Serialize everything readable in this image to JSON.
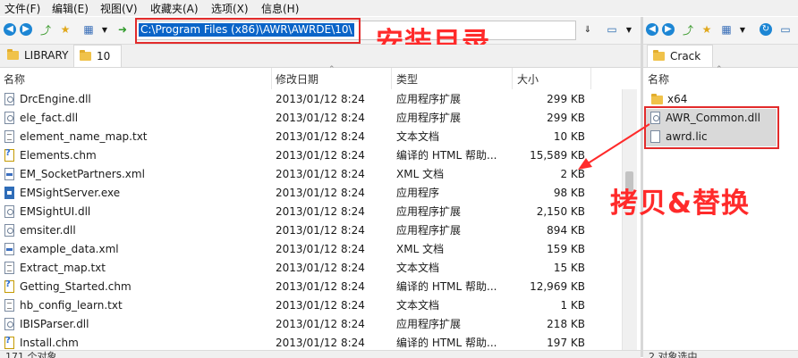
{
  "menu": [
    "文件(F)",
    "编辑(E)",
    "视图(V)",
    "收藏夹(A)",
    "选项(X)",
    "信息(H)"
  ],
  "address": {
    "path": "C:\\Program Files (x86)\\AWR\\AWRDE\\10\\"
  },
  "annotations": {
    "install_dir": "安装目录",
    "copy_replace": "拷贝&替换"
  },
  "left_tabs": [
    {
      "label": "LIBRARY"
    },
    {
      "label": "10"
    }
  ],
  "columns": {
    "name": "名称",
    "date": "修改日期",
    "type": "类型",
    "size": "大小"
  },
  "files": [
    {
      "name": "DrcEngine.dll",
      "date": "2013/01/12 8:24",
      "type": "应用程序扩展",
      "size": "299 KB",
      "icon": "dll-file-icon"
    },
    {
      "name": "ele_fact.dll",
      "date": "2013/01/12 8:24",
      "type": "应用程序扩展",
      "size": "299 KB",
      "icon": "dll-file-icon"
    },
    {
      "name": "element_name_map.txt",
      "date": "2013/01/12 8:24",
      "type": "文本文档",
      "size": "10 KB",
      "icon": "txt-file-icon"
    },
    {
      "name": "Elements.chm",
      "date": "2013/01/12 8:24",
      "type": "编译的 HTML 帮助...",
      "size": "15,589 KB",
      "icon": "chm-file-icon"
    },
    {
      "name": "EM_SocketPartners.xml",
      "date": "2013/01/12 8:24",
      "type": "XML 文档",
      "size": "2 KB",
      "icon": "xml-file-icon"
    },
    {
      "name": "EMSightServer.exe",
      "date": "2013/01/12 8:24",
      "type": "应用程序",
      "size": "98 KB",
      "icon": "exe-file-icon"
    },
    {
      "name": "EMSightUI.dll",
      "date": "2013/01/12 8:24",
      "type": "应用程序扩展",
      "size": "2,150 KB",
      "icon": "dll-file-icon"
    },
    {
      "name": "emsiter.dll",
      "date": "2013/01/12 8:24",
      "type": "应用程序扩展",
      "size": "894 KB",
      "icon": "dll-file-icon"
    },
    {
      "name": "example_data.xml",
      "date": "2013/01/12 8:24",
      "type": "XML 文档",
      "size": "159 KB",
      "icon": "xml-file-icon"
    },
    {
      "name": "Extract_map.txt",
      "date": "2013/01/12 8:24",
      "type": "文本文档",
      "size": "15 KB",
      "icon": "txt-file-icon"
    },
    {
      "name": "Getting_Started.chm",
      "date": "2013/01/12 8:24",
      "type": "编译的 HTML 帮助...",
      "size": "12,969 KB",
      "icon": "chm-file-icon"
    },
    {
      "name": "hb_config_learn.txt",
      "date": "2013/01/12 8:24",
      "type": "文本文档",
      "size": "1 KB",
      "icon": "txt-file-icon"
    },
    {
      "name": "IBISParser.dll",
      "date": "2013/01/12 8:24",
      "type": "应用程序扩展",
      "size": "218 KB",
      "icon": "dll-file-icon"
    },
    {
      "name": "Install.chm",
      "date": "2013/01/12 8:24",
      "type": "编译的 HTML 帮助...",
      "size": "197 KB",
      "icon": "chm-file-icon"
    }
  ],
  "right_pane": {
    "tab_label": "Crack",
    "column_name": "名称",
    "items": [
      {
        "name": "x64",
        "icon": "folder-icon"
      },
      {
        "name": "AWR_Common.dll",
        "icon": "dll-file-icon"
      },
      {
        "name": "awrd.lic",
        "icon": "file-icon"
      }
    ]
  },
  "status": {
    "left": "171 个对象",
    "right": "2 对象选中"
  },
  "colors": {
    "annotation_red": "#ff2a2a",
    "selection_blue": "#0a64c8",
    "folder_yellow": "#f0c24a"
  }
}
